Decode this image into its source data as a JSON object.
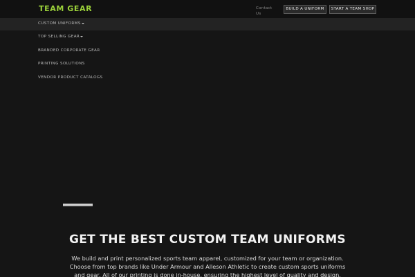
{
  "header": {
    "logo": "TEAM GEAR",
    "contact_label": "Contact Us",
    "build_uniform_label": "BUILD A UNIFORM",
    "start_shop_label": "START A TEAM SHOP"
  },
  "menu": {
    "items": [
      {
        "label": "CUSTOM UNIFORMS",
        "has_caret": true
      },
      {
        "label": "TOP SELLING GEAR",
        "has_caret": true
      },
      {
        "label": "BRANDED CORPORATE GEAR",
        "has_caret": false
      },
      {
        "label": "PRINTING SOLUTIONS",
        "has_caret": false
      },
      {
        "label": "VENDOR PRODUCT CATALOGS",
        "has_caret": false
      }
    ]
  },
  "hero": {
    "title": "GET THE BEST CUSTOM TEAM UNIFORMS",
    "text": "We build and print personalized sports team apparel, customized for your team or organization. Choose from top brands like Under Armour and Alleson Athletic to create custom sports uniforms and gear. All of our printing is done in-house, ensuring the highest level of quality and design."
  },
  "colors": {
    "brand": "#9bd13a",
    "background": "#151515"
  }
}
